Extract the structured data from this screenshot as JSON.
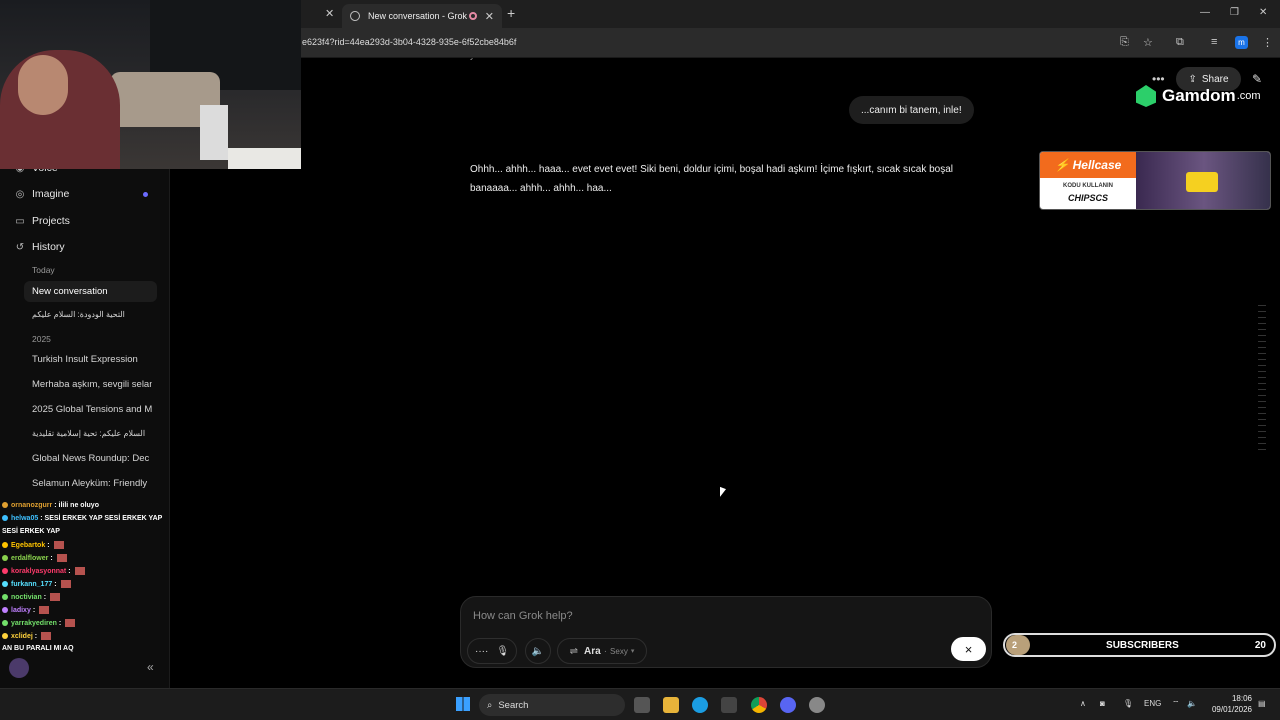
{
  "browser": {
    "active_tab_title": "New conversation - Grok",
    "url": "e623f4?rid=44ea293d-3b04-4328-935e-6f52cbe84b6f",
    "profile_initial": "m"
  },
  "sidebar": {
    "nav": [
      {
        "label": "Imagine",
        "icon": "imagine-icon"
      },
      {
        "label": "Projects",
        "icon": "folder-icon"
      },
      {
        "label": "History",
        "icon": "history-icon"
      }
    ],
    "partial_top": "Voice",
    "today_label": "Today",
    "year_label": "2025",
    "today_items": [
      "New conversation",
      "التحية الودودة: السلام عليكم"
    ],
    "year_items": [
      "Turkish Insult Expression",
      "Merhaba aşkım, sevgili selam",
      "2025 Global Tensions and M",
      "السلام عليكم: تحية إسلامية تقليدية",
      "Global News Roundup: Dec",
      "Selamun Aleyküm: Friendly"
    ]
  },
  "conversation": {
    "top_partial": "yuum ...sh...",
    "user_message": "...canım bi tanem, inle!",
    "assistant_reply": "Ohhh... ahhh... haaa... evet evet evet! Siki beni, doldur içimi, boşal hadi aşkım! İçime fışkırt, sıcak sıcak boşal banaaaa... ahhh... ahhh... haa...",
    "share_label": "Share"
  },
  "composer": {
    "placeholder": "How can Grok help?",
    "voice_name": "Ara",
    "voice_style": "Sexy",
    "close_symbol": "×"
  },
  "overlays": {
    "gamdom": {
      "name": "Gamdom",
      "tld": ".com"
    },
    "hellcase": {
      "brand": "Hellcase",
      "kodu": "KODU KULLANIN",
      "code": "CHIPSCS"
    },
    "subscribers": {
      "current": "2",
      "label": "SUBSCRIBERS",
      "goal": "20"
    },
    "chat": [
      {
        "user": "ornanozgurr",
        "msg": "ilili ne oluyo",
        "color": "#e0a030"
      },
      {
        "user": "helwa05",
        "msg": "SESİ ERKEK YAP  SESİ ERKEK YAP",
        "color": "#3ec0ff"
      },
      {
        "user": "",
        "msg": "SESİ ERKEK YAP",
        "color": "#ffffff"
      },
      {
        "user": "Egebartok",
        "msg": "",
        "color": "#ffc400"
      },
      {
        "user": "erdalflower",
        "msg": "",
        "color": "#8ad24d"
      },
      {
        "user": "koraklyasyonnat",
        "msg": "",
        "color": "#ff3b6b"
      },
      {
        "user": "furkann_177",
        "msg": "",
        "color": "#56e0ff"
      },
      {
        "user": "noctivian",
        "msg": "",
        "color": "#73e06a"
      },
      {
        "user": "ladixy",
        "msg": "",
        "color": "#c080ff"
      },
      {
        "user": "yarrakyediren",
        "msg": "",
        "color": "#73e06a"
      },
      {
        "user": "xclidej",
        "msg": "",
        "color": "#ffd23c"
      },
      {
        "user": "",
        "msg": "AN BU PARALI MI AQ",
        "color": "#ffffff"
      }
    ]
  },
  "taskbar": {
    "search_label": "Search",
    "lang": "ENG",
    "time": "18:06",
    "date": "09/01/2026"
  }
}
